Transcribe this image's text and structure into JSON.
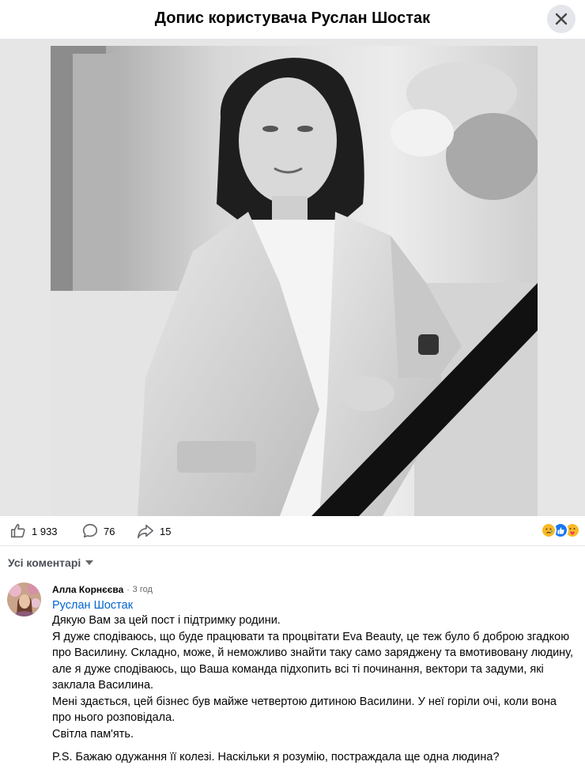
{
  "header": {
    "title": "Допис користувача Руслан Шостак",
    "close_icon": "close-icon"
  },
  "post": {
    "photo_description_icon": "photo",
    "likes": "1 933",
    "comments": "76",
    "shares": "15",
    "reactions": [
      "sad",
      "like",
      "care"
    ],
    "colors": {
      "like_blue": "#1877f2",
      "sad_yellow": "#f7b928",
      "mourning_ribbon": "#111111"
    }
  },
  "comments_section": {
    "sort_label": "Усі коментарі"
  },
  "comment": {
    "author": "Алла Корнєєва",
    "time": "3 год",
    "mention": "Руслан Шостак",
    "text": "Дякую Вам за цей пост і підтримку родини.\nЯ дуже сподіваюсь, що буде працювати та процвітати Eva Beauty, це теж було б доброю згадкою про Василину. Складно, може, й неможливо знайти таку само заряджену та вмотивовану людину, але я дуже сподіваюсь, що Ваша команда підхопить всі ті починання, вектори та задуми, які заклала Василина.\nМені здається, цей бізнес був майже четвертою дитиною Василини. У неї горіли очі, коли вона про нього розповідала.\nСвітла пам'ять.",
    "ps": "P.S. Бажаю одужання її колезі. Наскільки я розумію, постраждала ще одна людина?"
  }
}
